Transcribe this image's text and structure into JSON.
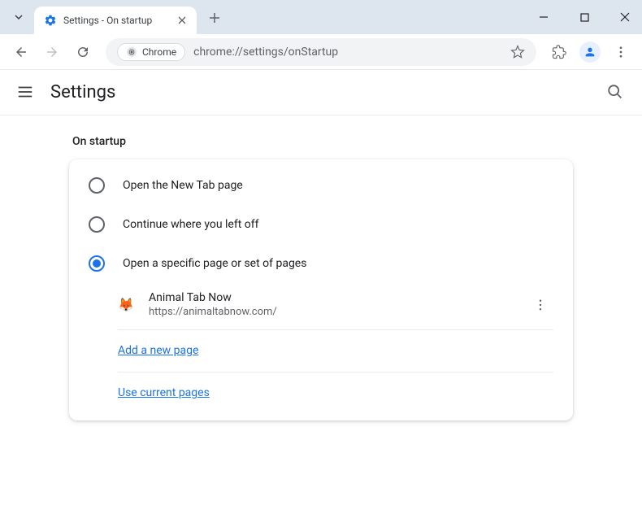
{
  "titlebar": {
    "tab_title": "Settings - On startup"
  },
  "toolbar": {
    "omnibox_chip": "Chrome",
    "omnibox_url": "chrome://settings/onStartup"
  },
  "header": {
    "title": "Settings"
  },
  "section": {
    "heading": "On startup",
    "options": [
      {
        "label": "Open the New Tab page",
        "selected": false
      },
      {
        "label": "Continue where you left off",
        "selected": false
      },
      {
        "label": "Open a specific page or set of pages",
        "selected": true
      }
    ],
    "pages": [
      {
        "name": "Animal Tab Now",
        "url": "https://animaltabnow.com/",
        "favicon": "🦊"
      }
    ],
    "add_page_label": "Add a new page",
    "use_current_label": "Use current pages"
  }
}
